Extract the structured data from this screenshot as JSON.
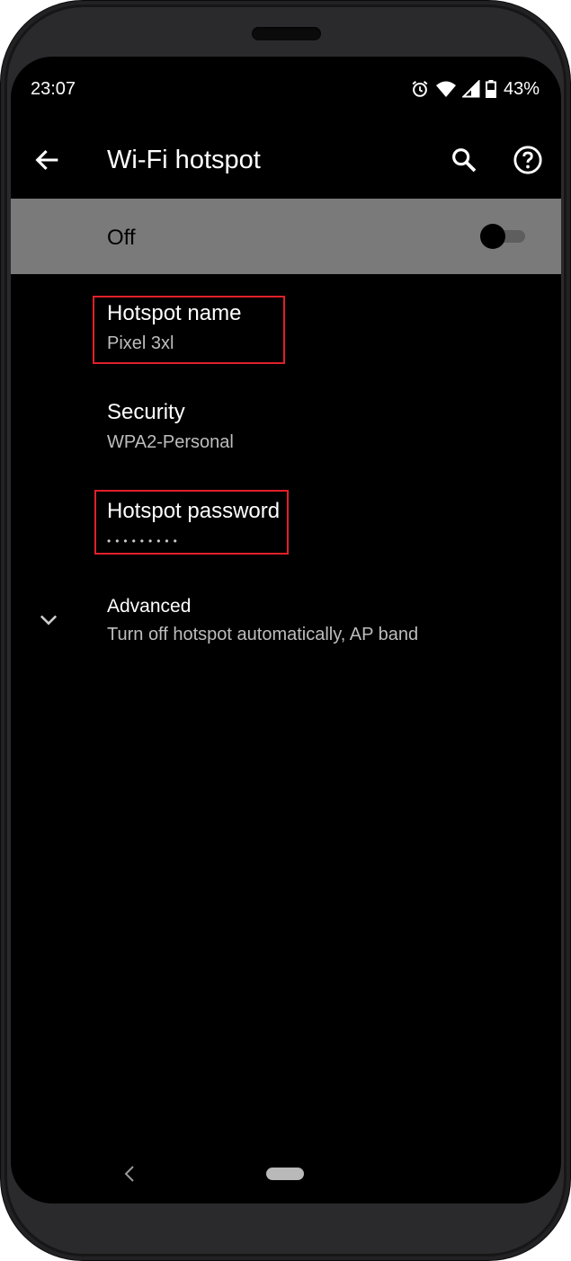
{
  "status_bar": {
    "time": "23:07",
    "battery_percent": "43%",
    "icons": [
      "alarm-icon",
      "wifi-icon",
      "signal-icon",
      "battery-icon"
    ]
  },
  "app_bar": {
    "title": "Wi-Fi hotspot",
    "icons": [
      "back-arrow-icon",
      "search-icon",
      "help-icon"
    ]
  },
  "main_toggle": {
    "label": "Off",
    "enabled": false
  },
  "settings": {
    "hotspot_name": {
      "title": "Hotspot name",
      "summary": "Pixel 3xl"
    },
    "security": {
      "title": "Security",
      "summary": "WPA2-Personal"
    },
    "hotspot_password": {
      "title": "Hotspot password",
      "summary": "•••••••••"
    },
    "advanced": {
      "title": "Advanced",
      "summary": "Turn off hotspot automatically, AP band"
    }
  },
  "colors": {
    "highlight": "#e0202a",
    "toggle_row_bg": "#7a7a7a",
    "screen_bg": "#000000"
  }
}
